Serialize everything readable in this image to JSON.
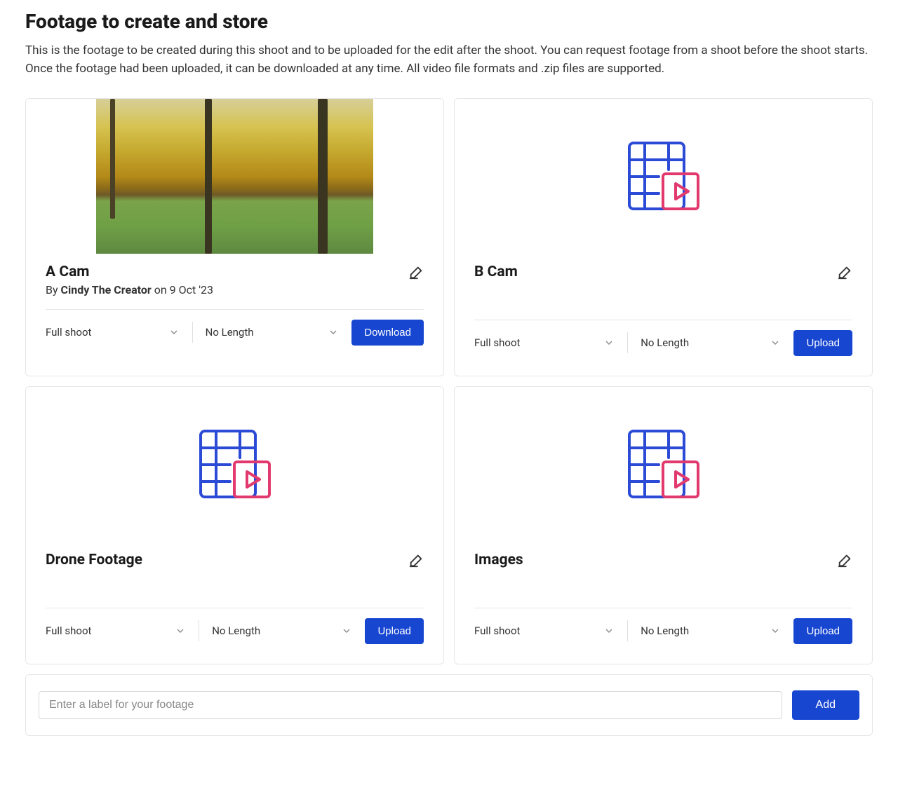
{
  "header": {
    "title": "Footage to create and store",
    "description": "This is the footage to be created during this shoot and to be uploaded for the edit after the shoot. You can request footage from a shoot before the shoot starts. Once the footage had been uploaded, it can be downloaded at any time. All video file formats and .zip files are supported."
  },
  "cards": [
    {
      "title": "A Cam",
      "has_thumbnail": true,
      "byline_prefix": "By ",
      "author": "Cindy The Creator",
      "byline_suffix": " on 9 Oct '23",
      "shoot_select": "Full shoot",
      "length_select": "No Length",
      "action_label": "Download"
    },
    {
      "title": "B Cam",
      "has_thumbnail": false,
      "shoot_select": "Full shoot",
      "length_select": "No Length",
      "action_label": "Upload"
    },
    {
      "title": "Drone Footage",
      "has_thumbnail": false,
      "shoot_select": "Full shoot",
      "length_select": "No Length",
      "action_label": "Upload"
    },
    {
      "title": "Images",
      "has_thumbnail": false,
      "shoot_select": "Full shoot",
      "length_select": "No Length",
      "action_label": "Upload"
    }
  ],
  "add": {
    "placeholder": "Enter a label for your footage",
    "button_label": "Add"
  }
}
